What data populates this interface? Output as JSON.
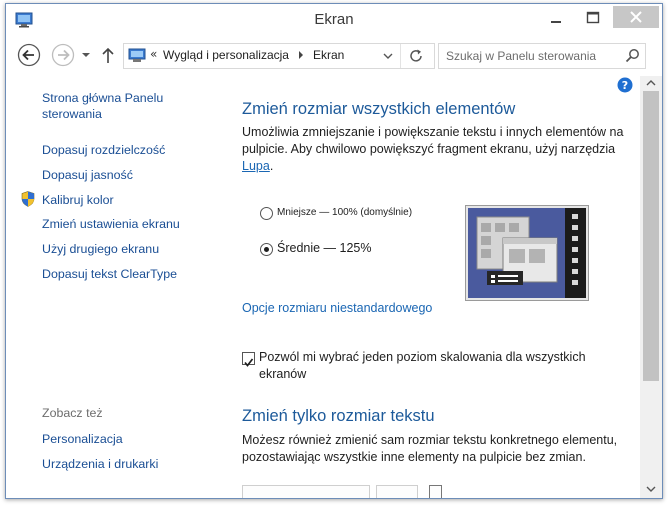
{
  "window": {
    "title": "Ekran"
  },
  "navigation": {
    "breadcrumb": [
      "Wygląd i personalizacja",
      "Ekran"
    ],
    "breadcrumb_prefix": "«",
    "search_placeholder": "Szukaj w Panelu sterowania"
  },
  "sidebar": {
    "home_link": "Strona główna Panelu sterowania",
    "links": [
      "Dopasuj rozdzielczość",
      "Dopasuj jasność",
      "Kalibruj kolor",
      "Zmień ustawienia ekranu",
      "Użyj drugiego ekranu",
      "Dopasuj tekst ClearType"
    ],
    "see_also_label": "Zobacz też",
    "see_also": [
      "Personalizacja",
      "Urządzenia i drukarki"
    ]
  },
  "main": {
    "section1_title": "Zmień rozmiar wszystkich elementów",
    "section1_desc": "Umożliwia zmniejszanie i powiększanie tekstu i innych elementów na pulpicie. Aby chwilowo powiększyć fragment ekranu, użyj narzędzia",
    "magnifier_link": "Lupa",
    "magnifier_suffix": ".",
    "radio_options": [
      {
        "label": "Mniejsze — 100% (domyślnie)",
        "selected": false
      },
      {
        "label": "Średnie — 125%",
        "selected": true
      }
    ],
    "custom_size_link": "Opcje rozmiaru niestandardowego",
    "scaling_checkbox_label": "Pozwól mi wybrać jeden poziom skalowania dla wszystkich ekranów",
    "scaling_checkbox_checked": true,
    "section2_title": "Zmień tylko rozmiar tekstu",
    "section2_desc": "Możesz również zmienić sam rozmiar tekstu konkretnego elementu, pozostawiając wszystkie inne elementy na pulpicie bez zmian."
  },
  "colors": {
    "heading": "#1d5a9a",
    "link": "#1a66b3",
    "preview_bg": "#4a5a9e",
    "preview_taskbar": "#1b1b1b"
  }
}
